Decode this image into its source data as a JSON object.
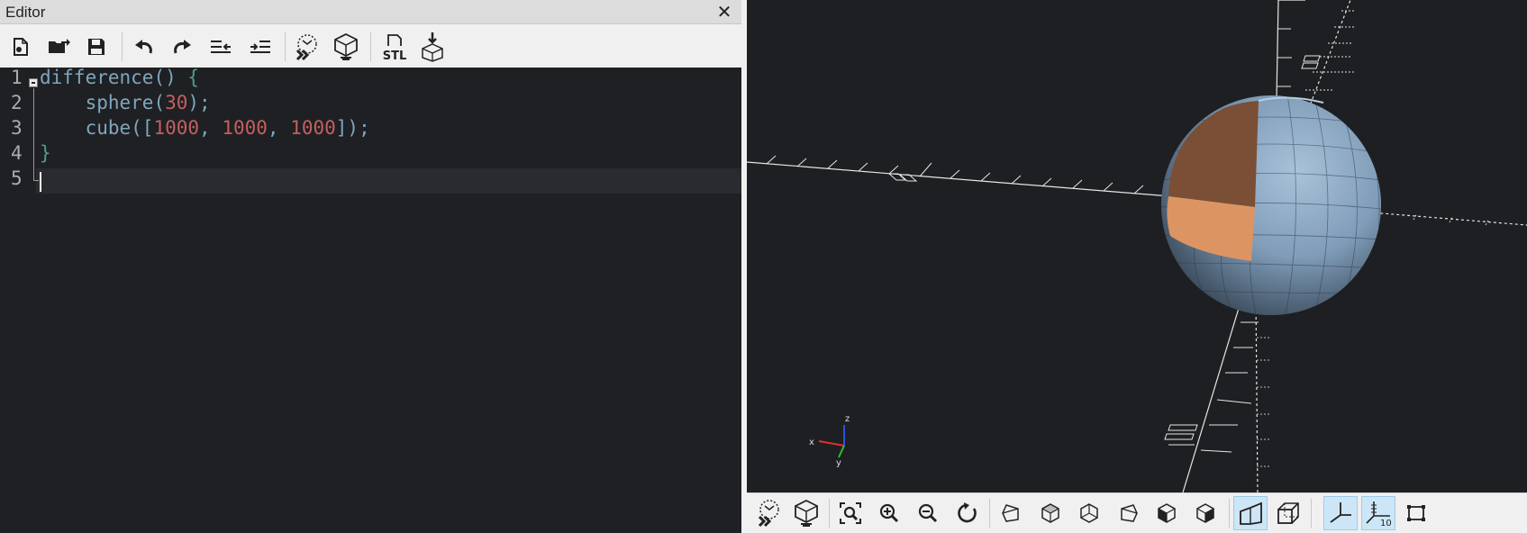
{
  "editor": {
    "title": "Editor",
    "close_label": "✕",
    "toolbar": [
      {
        "name": "new-file-icon",
        "tooltip": "New"
      },
      {
        "name": "open-folder-icon",
        "tooltip": "Open"
      },
      {
        "name": "save-icon",
        "tooltip": "Save"
      },
      {
        "name": "undo-icon",
        "tooltip": "Undo"
      },
      {
        "name": "redo-icon",
        "tooltip": "Redo"
      },
      {
        "name": "unindent-icon",
        "tooltip": "Unindent"
      },
      {
        "name": "indent-icon",
        "tooltip": "Indent"
      },
      {
        "name": "preview-icon",
        "tooltip": "Preview"
      },
      {
        "name": "render-icon",
        "tooltip": "Render"
      },
      {
        "name": "export-stl-icon",
        "tooltip": "Export STL",
        "label": "STL"
      },
      {
        "name": "send-to-print-icon",
        "tooltip": "Send to 3D Print"
      }
    ],
    "code": {
      "line_numbers": [
        "1",
        "2",
        "3",
        "4",
        "5"
      ],
      "line1": {
        "fn": "difference",
        "punc": "() ",
        "brace": "{"
      },
      "line2": {
        "indent": "    ",
        "fn": "sphere",
        "open": "(",
        "arg": "30",
        "close": ");"
      },
      "line3": {
        "indent": "    ",
        "fn": "cube",
        "open": "([",
        "a": "1000",
        "sep1": ", ",
        "b": "1000",
        "sep2": ", ",
        "c": "1000",
        "close": "]);"
      },
      "line4": {
        "brace": "}"
      },
      "line5": {
        "text": ""
      }
    }
  },
  "viewport": {
    "axis_labels": {
      "x": "x",
      "y": "y",
      "z": "z"
    },
    "colors": {
      "background": "#1e1f22",
      "sphere": "#7f9cb8",
      "cut_top": "#7a4f35",
      "cut_bottom": "#dc9562",
      "axes_lines": "#ffffff",
      "gizmo_x": "#e03030",
      "gizmo_y": "#30c030",
      "gizmo_z": "#3050e0"
    }
  },
  "view_toolbar": {
    "buttons": [
      {
        "name": "preview-icon",
        "tooltip": "Preview"
      },
      {
        "name": "render-icon",
        "tooltip": "Render"
      },
      {
        "name": "view-all-icon",
        "tooltip": "View All"
      },
      {
        "name": "zoom-in-icon",
        "tooltip": "Zoom In"
      },
      {
        "name": "zoom-out-icon",
        "tooltip": "Zoom Out"
      },
      {
        "name": "reset-view-icon",
        "tooltip": "Reset View"
      },
      {
        "name": "view-right-icon",
        "tooltip": "Right"
      },
      {
        "name": "view-top-icon",
        "tooltip": "Top"
      },
      {
        "name": "view-bottom-icon",
        "tooltip": "Bottom"
      },
      {
        "name": "view-left-icon",
        "tooltip": "Left"
      },
      {
        "name": "view-front-icon",
        "tooltip": "Front"
      },
      {
        "name": "view-back-icon",
        "tooltip": "Back"
      },
      {
        "name": "perspective-icon",
        "tooltip": "Perspective",
        "active": true
      },
      {
        "name": "orthogonal-icon",
        "tooltip": "Orthogonal"
      },
      {
        "name": "show-axes-icon",
        "tooltip": "Show Axes",
        "active": true
      },
      {
        "name": "show-scale-markers-icon",
        "tooltip": "Show Scale Markers",
        "active": true,
        "label": "10"
      },
      {
        "name": "show-edges-icon",
        "tooltip": "Show Edges"
      }
    ]
  }
}
